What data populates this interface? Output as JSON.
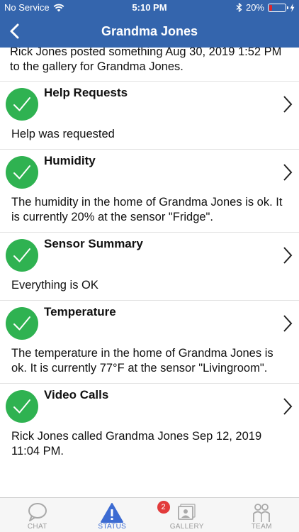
{
  "status_bar": {
    "carrier": "No Service",
    "time": "5:10 PM",
    "battery_percent": "20%",
    "battery_level": 0.2
  },
  "nav": {
    "title": "Grandma Jones"
  },
  "feed": {
    "top_text": "Rick Jones posted something Aug 30, 2019 1:52 PM to the gallery for Grandma Jones.",
    "items": [
      {
        "title": "Help Requests",
        "body": "Help was requested"
      },
      {
        "title": "Humidity",
        "body": "The humidity in the home of Grandma Jones is ok.  It is currently 20% at the sensor \"Fridge\"."
      },
      {
        "title": "Sensor Summary",
        "body": "Everything is OK"
      },
      {
        "title": "Temperature",
        "body": "The temperature in the home of Grandma Jones is ok.  It is currently 77°F at the sensor \"Livingroom\"."
      },
      {
        "title": "Video Calls",
        "body": "Rick Jones called Grandma Jones Sep 12, 2019 11:04 PM."
      }
    ]
  },
  "tabs": [
    {
      "label": "CHAT",
      "icon": "chat-bubble-icon"
    },
    {
      "label": "STATUS",
      "icon": "warning-triangle-icon",
      "badge": "2"
    },
    {
      "label": "GALLERY",
      "icon": "photo-gallery-icon"
    },
    {
      "label": "TEAM",
      "icon": "team-people-icon"
    }
  ],
  "colors": {
    "header": "#3465ad",
    "check": "#2fb251",
    "active_tab": "#3c6bd2",
    "badge": "#e23b3b",
    "battery_low": "#e0242b"
  }
}
